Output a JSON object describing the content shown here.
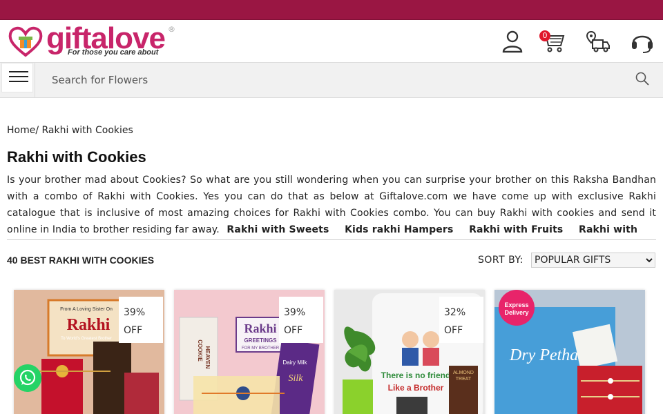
{
  "header": {
    "logo": {
      "wordmark": "giftalove",
      "registered": "®",
      "tagline": "For those you care about"
    },
    "cart_count": "0",
    "icons": [
      "user-icon",
      "cart-icon",
      "track-order-icon",
      "support-icon"
    ]
  },
  "search": {
    "placeholder": "Search for Flowers"
  },
  "breadcrumb": {
    "home": "Home",
    "separator": "/",
    "current": "Rakhi with Cookies"
  },
  "page": {
    "title": "Rakhi with Cookies",
    "intro": "Is your brother mad about Cookies? So what are you still wondering when you can surprise your brother on this Raksha Bandhan with a combo of Rakhi with Cookies. Yes you can do that as below at Giftalove.com we have come up with exclusive Rakhi catalogue that is inclusive of most amazing choices for Rakhi with Cookies combo. You can buy Rakhi with cookies and send it online in India to brother residing far away.",
    "quick_links": [
      "Rakhi with Sweets",
      "Kids rakhi Hampers",
      "Rakhi with Fruits",
      "Rakhi with"
    ]
  },
  "listing": {
    "count_label": "40 BEST RAKHI WITH COOKIES",
    "sort_label": "SORT BY:",
    "sort_selected": "POPULAR GIFTS",
    "products": [
      {
        "discount": "39%",
        "off": "OFF",
        "image_text": [
          "From A Loving Sister On",
          "Rakhi",
          "To World's Greatest Brother"
        ]
      },
      {
        "discount": "39%",
        "off": "OFF",
        "image_text": [
          "COOKIE",
          "HEAVEN",
          "Rakhi",
          "GREETINGS",
          "FOR MY BROTHER",
          "Dairy Milk",
          "Silk"
        ]
      },
      {
        "discount": "32%",
        "off": "OFF",
        "image_text": [
          "There is no friend",
          "Like a Brother",
          "ALMOND",
          "TREAT"
        ]
      },
      {
        "discount": "",
        "off": "",
        "image_text": [
          "Express",
          "Delivery",
          "Dry Petha"
        ]
      }
    ]
  },
  "colors": {
    "brand": "#9a1643",
    "logo_pink": "#c8256a",
    "whatsapp": "#25d366",
    "badge_red": "#e0162b"
  }
}
